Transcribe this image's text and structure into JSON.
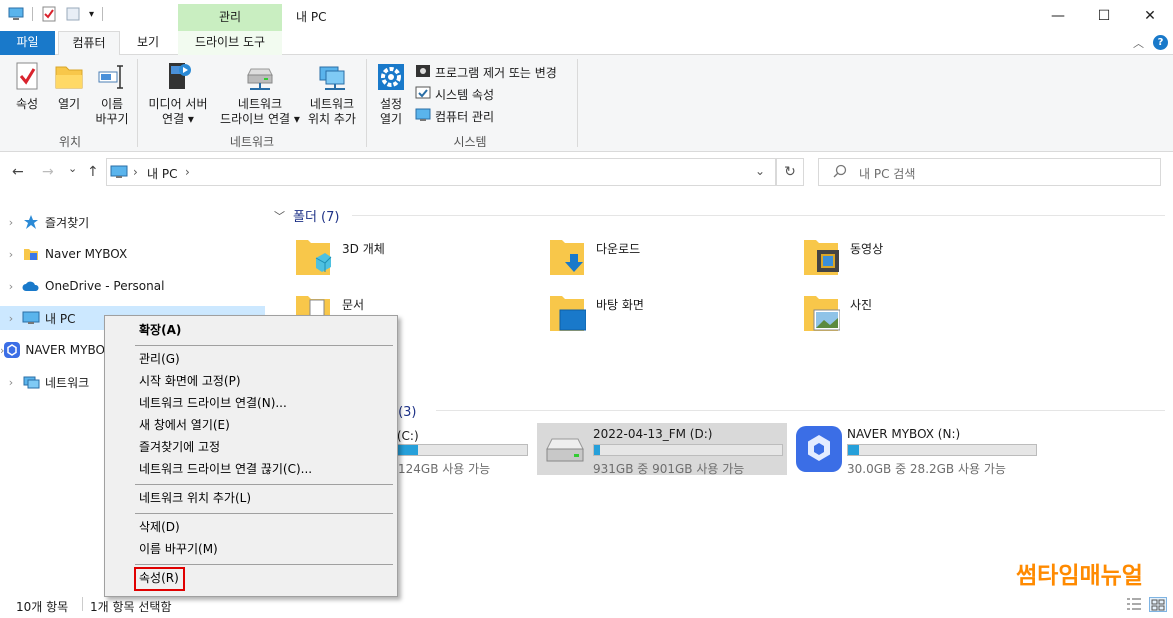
{
  "title_bar": {
    "context_tab_header": "관리",
    "window_title": "내 PC",
    "minimize": "—",
    "maximize": "☐",
    "close": "✕"
  },
  "tabs": {
    "file": "파일",
    "computer": "컴퓨터",
    "view": "보기",
    "drive_tools": "드라이브 도구"
  },
  "ribbon": {
    "location": {
      "properties": "속성",
      "open": "열기",
      "rename_line1": "이름",
      "rename_line2": "바꾸기",
      "label": "위치"
    },
    "network": {
      "media_server_line1": "미디어 서버",
      "media_server_line2": "연결 ▾",
      "map_drive_line1": "네트워크",
      "map_drive_line2": "드라이브 연결 ▾",
      "add_location_line1": "네트워크",
      "add_location_line2": "위치 추가",
      "label": "네트워크"
    },
    "system": {
      "settings_line1": "설정",
      "settings_line2": "열기",
      "uninstall": "프로그램 제거 또는 변경",
      "sys_props": "시스템 속성",
      "computer_mgmt": "컴퓨터 관리",
      "label": "시스템"
    }
  },
  "address": {
    "back": "←",
    "forward": "→",
    "recent": "⌄",
    "up": "↑",
    "path": "내 PC",
    "sep": "›",
    "dropdown": "⌄",
    "refresh": "↻",
    "search_placeholder": "내 PC 검색"
  },
  "nav": {
    "quick_access": "즐겨찾기",
    "naver_mybox": "Naver MYBOX",
    "onedrive": "OneDrive - Personal",
    "this_pc": "내 PC",
    "naver_mybox2": "NAVER MYBOX",
    "network": "네트워크"
  },
  "content": {
    "folders_header": "폴더 (7)",
    "folders": [
      "3D 개체",
      "다운로드",
      "동영상",
      "문서",
      "바탕 화면",
      "사진"
    ],
    "drives_header_partial": "브 (3)",
    "drive_c": {
      "name": "크 (C:)",
      "size": "124GB 사용 가능",
      "used_fraction": 0.3
    },
    "drive_d": {
      "name": "2022-04-13_FM (D:)",
      "size": "931GB 중 901GB 사용 가능",
      "used_fraction": 0.03
    },
    "drive_n": {
      "name": "NAVER MYBOX (N:)",
      "size": "30.0GB 중 28.2GB 사용 가능",
      "used_fraction": 0.06
    }
  },
  "context_menu": {
    "expand": "확장(A)",
    "manage": "관리(G)",
    "pin_start": "시작 화면에 고정(P)",
    "map_drive": "네트워크 드라이브 연결(N)...",
    "open_new_window": "새 창에서 열기(E)",
    "pin_quick": "즐겨찾기에 고정",
    "disconnect": "네트워크 드라이브 연결 끊기(C)...",
    "add_location": "네트워크 위치 추가(L)",
    "delete": "삭제(D)",
    "rename": "이름 바꾸기(M)",
    "properties": "속성(R)"
  },
  "status": {
    "items": "10개 항목",
    "selected": "1개 항목 선택함"
  },
  "watermark": "썸타임매뉴얼",
  "colors": {
    "accent": "#1979ca",
    "selection": "#cce8ff",
    "highlight_box": "#e00000",
    "watermark": "#ff8a00"
  }
}
